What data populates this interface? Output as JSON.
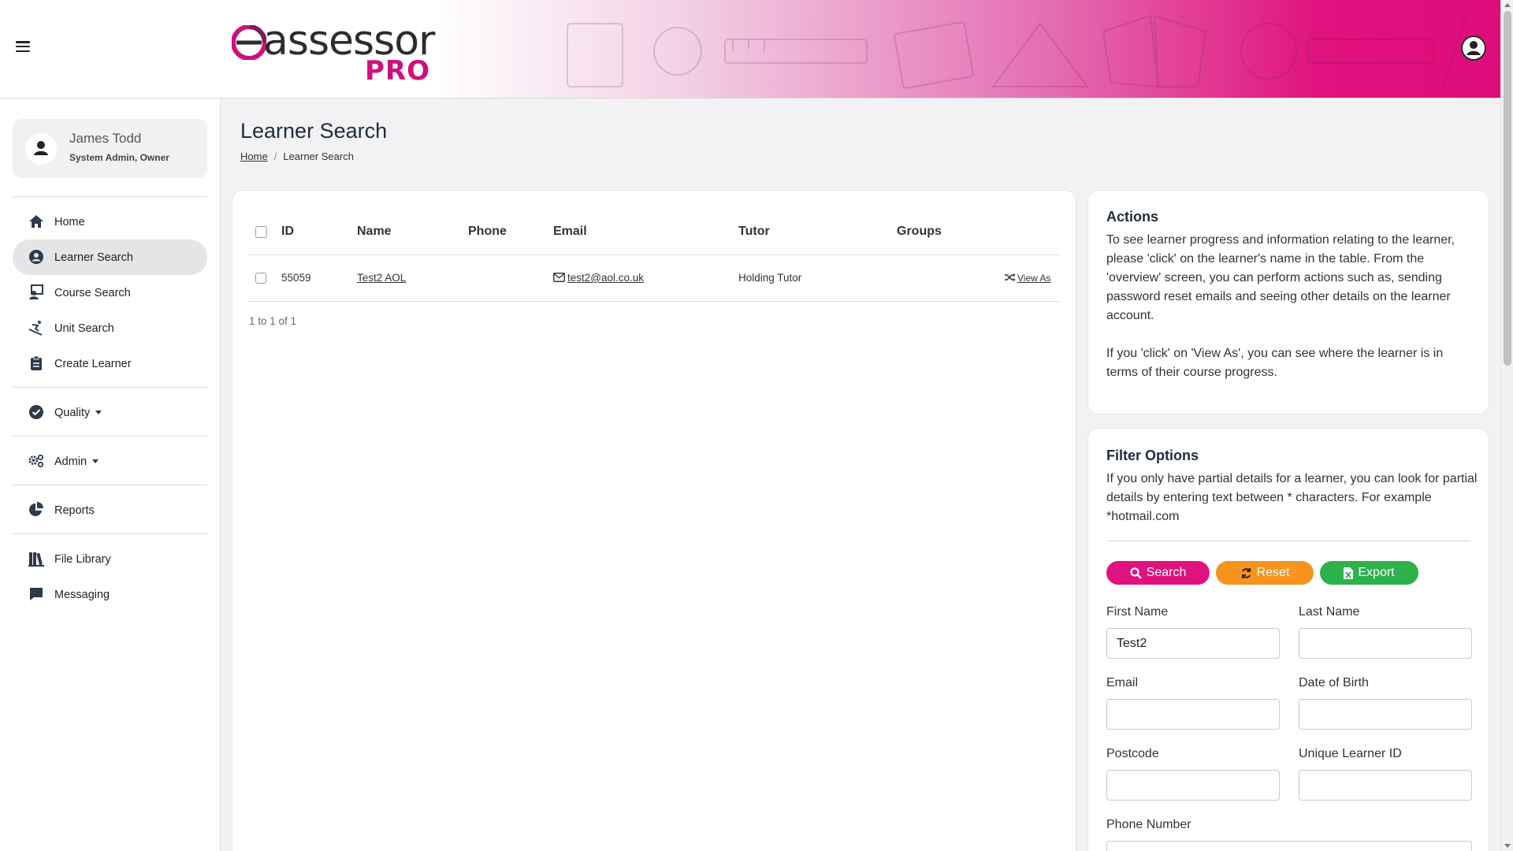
{
  "header": {
    "logo_main": "assessor",
    "logo_pro": "PRO"
  },
  "user": {
    "name": "James Todd",
    "role": "System Admin, Owner"
  },
  "sidebar": {
    "items": [
      {
        "label": "Home",
        "icon": "home-icon"
      },
      {
        "label": "Learner Search",
        "icon": "user-circle-icon",
        "active": true
      },
      {
        "label": "Course Search",
        "icon": "chalkboard-teacher-icon"
      },
      {
        "label": "Unit Search",
        "icon": "skiing-icon"
      },
      {
        "label": "Create Learner",
        "icon": "clipboard-icon"
      },
      {
        "label": "Quality",
        "icon": "check-circle-icon"
      },
      {
        "label": "Admin",
        "icon": "cogs-icon"
      },
      {
        "label": "Reports",
        "icon": "pie-chart-icon"
      },
      {
        "label": "File Library",
        "icon": "books-icon"
      },
      {
        "label": "Messaging",
        "icon": "comment-icon"
      }
    ]
  },
  "page": {
    "title": "Learner Search",
    "breadcrumb_home": "Home",
    "breadcrumb_current": "Learner Search"
  },
  "table": {
    "columns": [
      "ID",
      "Name",
      "Phone",
      "Email",
      "Tutor",
      "Groups"
    ],
    "rows": [
      {
        "id": "55059",
        "name": "Test2 AOL",
        "phone": "",
        "email": "test2@aol.co.uk",
        "tutor": "Holding Tutor",
        "groups": "",
        "action": "View As"
      }
    ],
    "pager": "1 to 1 of 1"
  },
  "actions": {
    "title": "Actions",
    "p1": "To see learner progress and information relating to the learner, please 'click' on the learner's name in the table. From the 'overview' screen, you can perform actions such as, sending password reset emails and seeing other details on the learner account.",
    "p2": "If you 'click' on 'View As', you can see where the learner is in terms of their course progress."
  },
  "filter": {
    "title": "Filter Options",
    "description": "If you only have partial details for a learner, you can look for partial details by entering text between * characters. For example *hotmail.com",
    "buttons": {
      "search": "Search",
      "reset": "Reset",
      "export": "Export"
    },
    "fields": {
      "first_name": {
        "label": "First Name",
        "value": "Test2"
      },
      "last_name": {
        "label": "Last Name",
        "value": ""
      },
      "email": {
        "label": "Email",
        "value": ""
      },
      "dob": {
        "label": "Date of Birth",
        "value": ""
      },
      "postcode": {
        "label": "Postcode",
        "value": ""
      },
      "uln": {
        "label": "Unique Learner ID",
        "value": ""
      },
      "phone": {
        "label": "Phone Number",
        "value": ""
      }
    }
  },
  "colors": {
    "brand_pink": "#e0127f",
    "reset_orange": "#f7931e",
    "export_green": "#2db14a"
  }
}
